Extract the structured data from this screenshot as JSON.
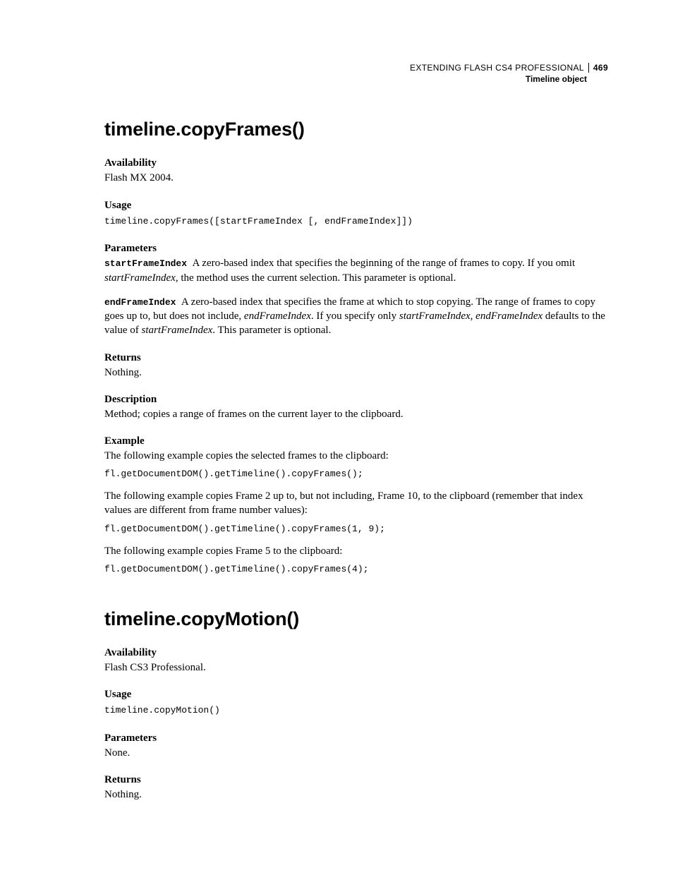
{
  "header": {
    "book_title": "EXTENDING FLASH CS4 PROFESSIONAL",
    "page_number": "469",
    "chapter": "Timeline object"
  },
  "methods": [
    {
      "title": "timeline.copyFrames()",
      "availability": {
        "label": "Availability",
        "body": "Flash MX 2004."
      },
      "usage": {
        "label": "Usage",
        "code": "timeline.copyFrames([startFrameIndex [, endFrameIndex]])"
      },
      "parameters": {
        "label": "Parameters",
        "items": [
          {
            "name": "startFrameIndex",
            "pre": "A zero-based index that specifies the beginning of the range of frames to copy. If you omit ",
            "em1": "startFrameIndex",
            "post": ", the method uses the current selection. This parameter is optional."
          },
          {
            "name": "endFrameIndex",
            "pre": "A zero-based index that specifies the frame at which to stop copying. The range of frames to copy goes up to, but does not include, ",
            "em1": "endFrameIndex",
            "mid1": ". If you specify only ",
            "em2": "startFrameIndex",
            "mid2": ", ",
            "em3": "endFrameIndex",
            "mid3": " defaults to the value of ",
            "em4": "startFrameIndex",
            "post": ". This parameter is optional."
          }
        ]
      },
      "returns": {
        "label": "Returns",
        "body": "Nothing."
      },
      "description": {
        "label": "Description",
        "body": "Method; copies a range of frames on the current layer to the clipboard."
      },
      "example": {
        "label": "Example",
        "intro1": "The following example copies the selected frames to the clipboard:",
        "code1": "fl.getDocumentDOM().getTimeline().copyFrames();",
        "intro2": "The following example copies Frame 2 up to, but not including, Frame 10, to the clipboard (remember that index values are different from frame number values):",
        "code2": "fl.getDocumentDOM().getTimeline().copyFrames(1, 9);",
        "intro3": "The following example copies Frame 5 to the clipboard:",
        "code3": "fl.getDocumentDOM().getTimeline().copyFrames(4);"
      }
    },
    {
      "title": "timeline.copyMotion()",
      "availability": {
        "label": "Availability",
        "body": "Flash CS3 Professional."
      },
      "usage": {
        "label": "Usage",
        "code": "timeline.copyMotion()"
      },
      "parameters": {
        "label": "Parameters",
        "body": "None."
      },
      "returns": {
        "label": "Returns",
        "body": "Nothing."
      }
    }
  ]
}
